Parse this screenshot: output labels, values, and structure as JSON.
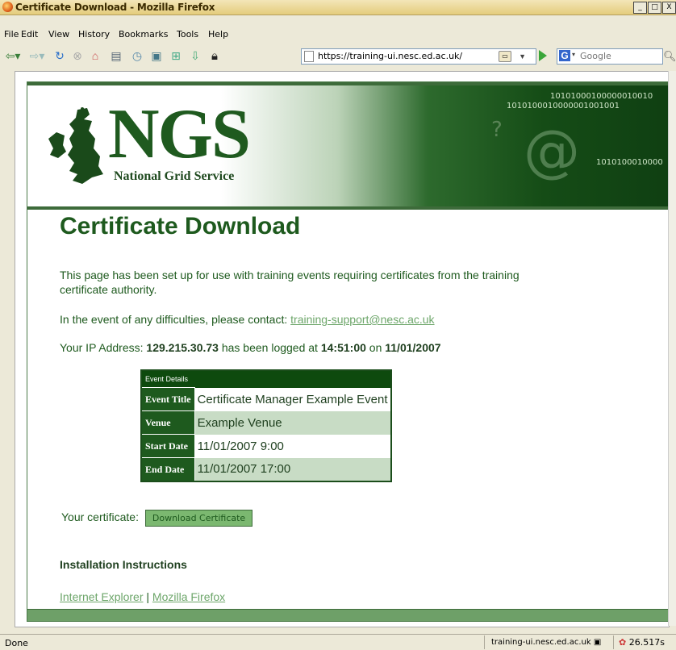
{
  "window": {
    "title": "Certificate Download - Mozilla Firefox",
    "controls": [
      "_",
      "□",
      "X"
    ]
  },
  "menu": [
    "File",
    "Edit",
    "View",
    "History",
    "Bookmarks",
    "Tools",
    "Help"
  ],
  "toolbar": {
    "url": "https://training-ui.nesc.ed.ac.uk/",
    "search_placeholder": "Google",
    "search_engine_icon": "G"
  },
  "banner": {
    "logo_text": "NGS",
    "logo_subtitle": "National Grid Service",
    "binary_1": "10101000100000010010",
    "binary_2": "1010100010000001001001",
    "binary_3": "1010100010000"
  },
  "page": {
    "heading": "Certificate Download",
    "intro_line1": "This page has been set up for use with training events requiring certificates from the training",
    "intro_line2": "certificate authority.",
    "contact_prefix": "In the event of any difficulties, please contact:",
    "contact_email": "training-support@nesc.ac.uk",
    "ip_prefix": "Your IP Address:",
    "ip": "129.215.30.73",
    "ip_mid": "has been logged at",
    "time": "14:51:00",
    "on": "on",
    "date": "11/01/2007",
    "cert_label": "Your certificate:",
    "download_button": "Download Certificate",
    "install_heading": "Installation Instructions",
    "link_ie": "Internet Explorer",
    "link_sep": "|",
    "link_ff": "Mozilla Firefox"
  },
  "event_table": {
    "header": "Event Details",
    "rows": [
      {
        "label": "Event Title",
        "value": "Certificate Manager Example Event"
      },
      {
        "label": "Venue",
        "value": "Example Venue"
      },
      {
        "label": "Start Date",
        "value": "11/01/2007 9:00"
      },
      {
        "label": "End Date",
        "value": "11/01/2007 17:00"
      }
    ]
  },
  "status": {
    "text": "Done",
    "host": "training-ui.nesc.ed.ac.uk",
    "timer": "26.517s"
  }
}
